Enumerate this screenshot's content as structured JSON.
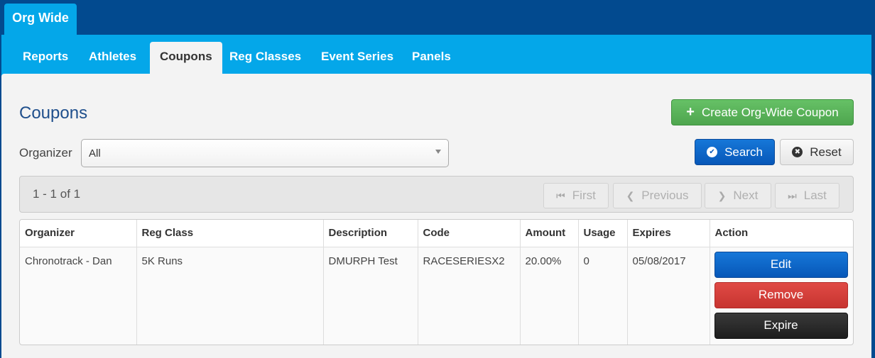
{
  "top_tab": {
    "label": "Org Wide"
  },
  "nav": {
    "tabs": [
      {
        "label": "Reports"
      },
      {
        "label": "Athletes"
      },
      {
        "label": "Coupons"
      },
      {
        "label": "Reg Classes"
      },
      {
        "label": "Event Series"
      },
      {
        "label": "Panels"
      }
    ],
    "active": "Coupons"
  },
  "page": {
    "title": "Coupons",
    "create_label": "Create Org-Wide Coupon"
  },
  "filter": {
    "organizer_label": "Organizer",
    "organizer_value": "All",
    "search_label": "Search",
    "reset_label": "Reset"
  },
  "pager": {
    "range": "1 - 1 of 1",
    "first": "First",
    "previous": "Previous",
    "next": "Next",
    "last": "Last"
  },
  "table": {
    "headers": [
      "Organizer",
      "Reg Class",
      "Description",
      "Code",
      "Amount",
      "Usage",
      "Expires",
      "Action"
    ],
    "rows": [
      {
        "organizer": "Chronotrack - Dan",
        "reg_class": "5K Runs",
        "description": "DMURPH Test",
        "code": "RACESERIESX2",
        "amount": "20.00%",
        "usage": "0",
        "expires": "05/08/2017"
      }
    ],
    "actions": {
      "edit": "Edit",
      "remove": "Remove",
      "expire": "Expire"
    }
  },
  "colors": {
    "header_bg": "#024a8f",
    "nav_bg": "#04a7e9",
    "create": "#5cb85c",
    "primary": "#0757b8",
    "danger": "#d9534f",
    "dark": "#222222"
  }
}
